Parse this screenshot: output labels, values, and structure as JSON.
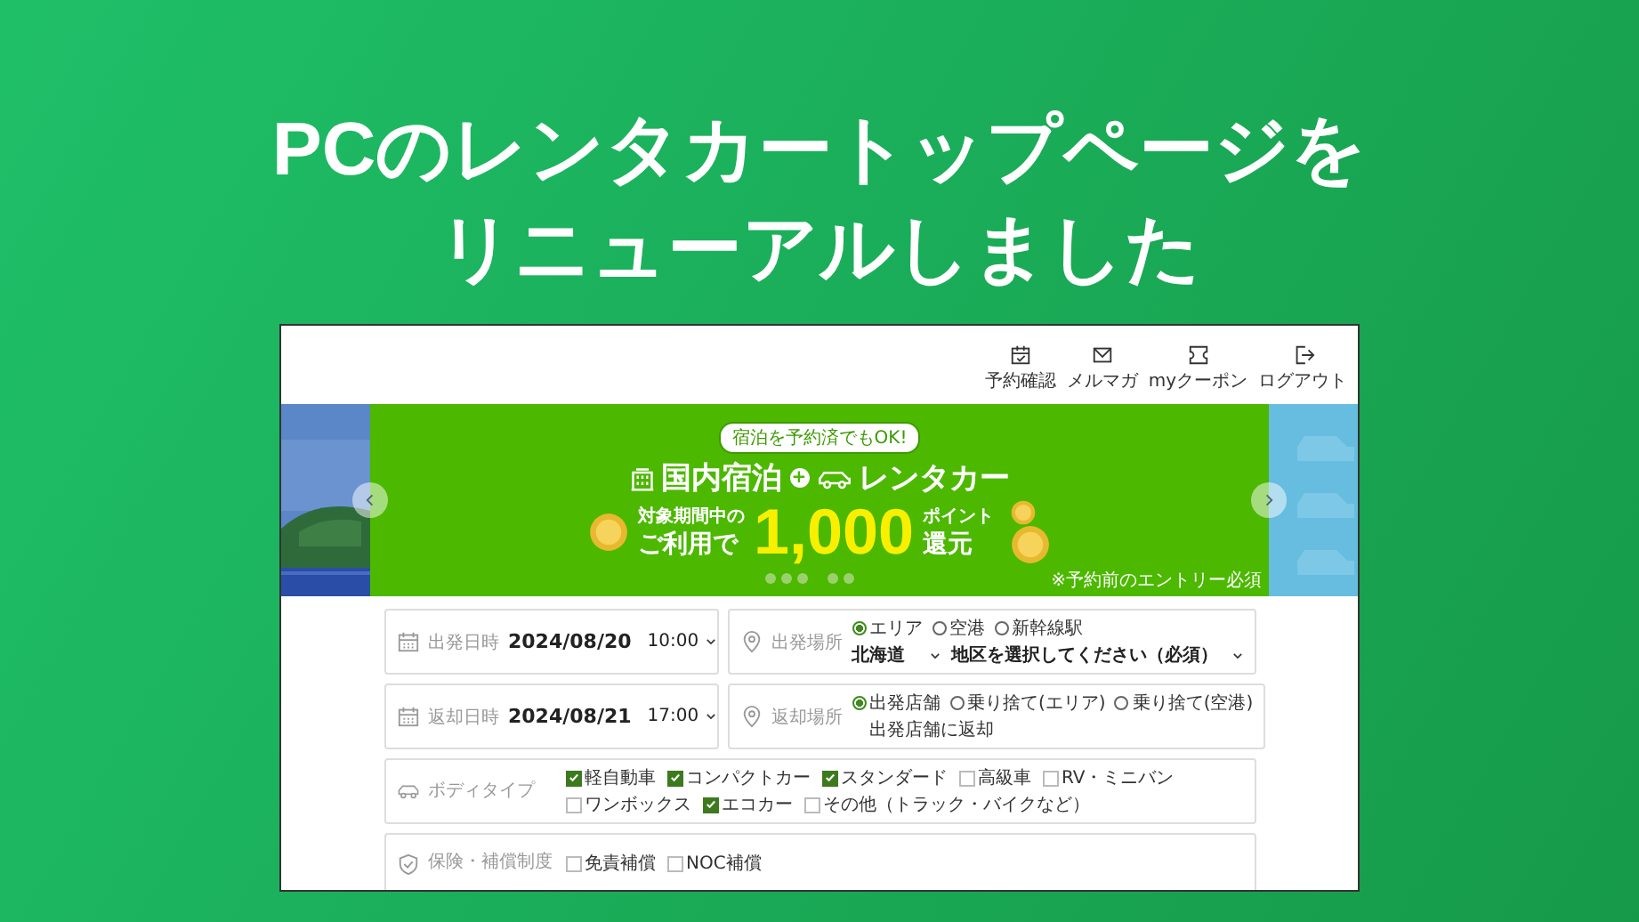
{
  "headline": [
    "PCのレンタカートップページを",
    "リニューアルしました"
  ],
  "header_links": [
    {
      "kind": "calendar",
      "label": "予約確認"
    },
    {
      "kind": "mail",
      "label": "メルマガ"
    },
    {
      "kind": "coupon",
      "label": "myクーポン"
    },
    {
      "kind": "logout",
      "label": "ログアウト"
    }
  ],
  "banner": {
    "bubble": "宿泊を予約済でもOK!",
    "title_left": "国内宿泊",
    "plus": "+",
    "title_right": "レンタカー",
    "lead_1": "対象期間中の",
    "lead_2": "ご利用で",
    "amount": "1,000",
    "unit_1": "ポイント",
    "unit_2": "還元",
    "note": "※予約前のエントリー必須",
    "dots": [
      {
        "selected": false
      },
      {
        "selected": false
      },
      {
        "selected": false
      },
      {
        "selected": false
      },
      {
        "selected": false
      }
    ]
  },
  "search_form": {
    "pickup_time": {
      "label": "出発日時",
      "date": "2024/08/20",
      "time": "10:00"
    },
    "pickup_place": {
      "label": "出発場所",
      "options": [
        {
          "label": "エリア",
          "selected": true
        },
        {
          "label": "空港",
          "selected": false
        },
        {
          "label": "新幹線駅",
          "selected": false
        }
      ],
      "prefecture": "北海道",
      "district": "地区を選択してください（必須）"
    },
    "return_time": {
      "label": "返却日時",
      "date": "2024/08/21",
      "time": "17:00"
    },
    "return_place": {
      "label": "返却場所",
      "options": [
        {
          "label": "出発店舗",
          "selected": true
        },
        {
          "label": "乗り捨て(エリア)",
          "selected": false
        },
        {
          "label": "乗り捨て(空港)",
          "selected": false
        }
      ],
      "note": "出発店舗に返却"
    },
    "body_type": {
      "label": "ボディタイプ",
      "options": [
        {
          "label": "軽自動車",
          "checked": true
        },
        {
          "label": "コンパクトカー",
          "checked": true
        },
        {
          "label": "スタンダード",
          "checked": true
        },
        {
          "label": "高級車",
          "checked": false
        },
        {
          "label": "RV・ミニバン",
          "checked": false
        },
        {
          "label": "ワンボックス",
          "checked": false
        },
        {
          "label": "エコカー",
          "checked": true
        },
        {
          "label": "その他（トラック・バイクなど）",
          "checked": false
        }
      ]
    },
    "insurance": {
      "label": "保険・補償制度",
      "options": [
        {
          "label": "免責補償",
          "checked": false
        },
        {
          "label": "NOC補償",
          "checked": false
        }
      ]
    }
  }
}
